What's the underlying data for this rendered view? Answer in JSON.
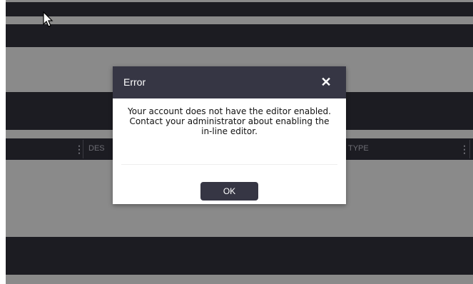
{
  "table": {
    "columns": [
      {
        "label": "DES"
      },
      {
        "label": "TYPE"
      }
    ]
  },
  "dialog": {
    "title": "Error",
    "close_icon": "close-icon",
    "message": "Your account does not have the editor enabled. Contact your administrator about enabling the in-line editor.",
    "ok_label": "OK"
  },
  "colors": {
    "backdrop": "#8a8a8a",
    "dark_band": "#1c1c22",
    "dialog_header": "#363644",
    "button": "#363644"
  }
}
